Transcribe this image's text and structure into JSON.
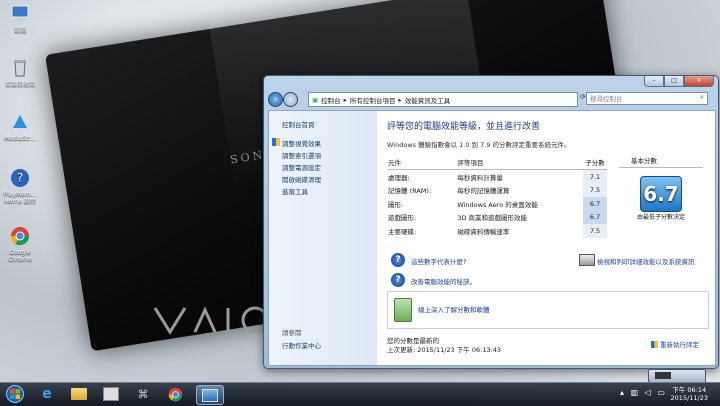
{
  "desktop": {
    "icons": [
      {
        "label": "電腦",
        "icon": "computer-icon"
      },
      {
        "label": "資源回收筒",
        "icon": "recycle-bin-icon"
      },
      {
        "label": "MediaStr...",
        "icon": "media-icon"
      },
      {
        "label": "PlayMem... Home 說明",
        "icon": "help-icon"
      },
      {
        "label": "Google Chrome",
        "icon": "chrome-icon"
      }
    ],
    "brand": "SONY"
  },
  "window": {
    "address": {
      "segments": [
        "控制台",
        "所有控制台項目",
        "效能資訊及工具"
      ]
    },
    "search_placeholder": "搜尋控制台",
    "sidebar": {
      "items": [
        "控制台首頁",
        "調整視覺效果",
        "調整索引選項",
        "調整電源設定",
        "開啟磁碟清理",
        "進階工具"
      ],
      "see_also_label": "請參閱",
      "see_also_items": [
        "行動作業中心"
      ]
    },
    "main": {
      "title": "評等您的電腦效能等級，並且進行改善",
      "description": "Windows 體驗指數會以 1.0 到 7.9 的分數評定重要系統元件。",
      "table_headers": [
        "元件",
        "評等項目",
        "子分數",
        "基本分數"
      ],
      "rows": [
        {
          "component": "處理器:",
          "rating": "每秒資料計算量",
          "score": "7.1"
        },
        {
          "component": "記憶體 (RAM):",
          "rating": "每秒的記憶體運算",
          "score": "7.5"
        },
        {
          "component": "圖形:",
          "rating": "Windows Aero 的桌面效能",
          "score": "6.7"
        },
        {
          "component": "遊戲圖形:",
          "rating": "3D 商業和遊戲圖形效能",
          "score": "6.7"
        },
        {
          "component": "主要硬碟:",
          "rating": "磁碟資料傳輸速率",
          "score": "7.5"
        }
      ],
      "base_score": "6.7",
      "base_score_note": "由最低子分數決定",
      "links": [
        "這些數字代表什麼?",
        "改善電腦效能的秘訣。",
        "檢視和列印詳細效能以及系統資訊",
        "線上深入了解分數和軟體"
      ],
      "footer_line1": "您的分數是最新的",
      "footer_line2": "上次更新: 2015/11/23 下午 06:13:43",
      "rerun": "重新執行評定"
    }
  },
  "taskbar": {
    "time": "下午 06:14",
    "date": "2015/11/23"
  }
}
